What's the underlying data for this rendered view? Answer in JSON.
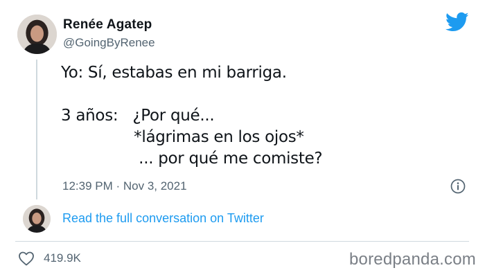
{
  "author": {
    "name": "Renée Agatep",
    "handle": "@GoingByRenee"
  },
  "tweet": {
    "text": "Yo: Sí, estabas en mi barriga.\n\n3 años:   ¿Por qué...\n               *lágrimas en los ojos*\n                ... por qué me comiste?",
    "timestamp": "12:39 PM · Nov 3, 2021"
  },
  "conversation_link": "Read the full conversation on Twitter",
  "likes": "419.9K",
  "watermark": "boredpanda.com",
  "icons": {
    "brand": "twitter-bird-icon",
    "info": "info-icon",
    "like": "heart-icon"
  },
  "colors": {
    "accent": "#1d9bf0",
    "muted_text": "#536471",
    "divider": "#cfd9de"
  }
}
